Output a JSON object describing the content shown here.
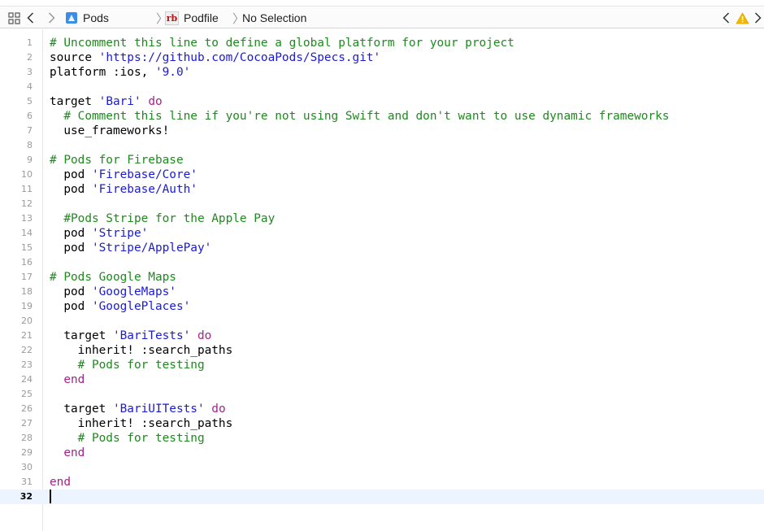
{
  "jumpbar": {
    "breadcrumbs": [
      "Pods",
      "Podfile",
      "No Selection"
    ],
    "icons": {
      "grid": "related-items-grid-icon",
      "back": "chevron-left-icon",
      "forward": "chevron-right-icon",
      "project": "xcode-project-icon",
      "ruby": "ruby-file-icon",
      "warning": "warning-triangle-icon"
    },
    "ruby_icon_label": "rb",
    "colors": {
      "warning": "#f5b800",
      "project_icon": "#3b8ee8"
    }
  },
  "editor": {
    "current_line": 32,
    "colors": {
      "comment": "#1e8a1e",
      "string": "#1a1ad6",
      "keyword": "#a3238c",
      "text": "#000000"
    },
    "lines": [
      {
        "n": "1",
        "segs": [
          {
            "t": "# Uncomment this line to define a global platform for your project",
            "c": "cmt"
          }
        ]
      },
      {
        "n": "2",
        "segs": [
          {
            "t": "source ",
            "c": ""
          },
          {
            "t": "'https://github.com/CocoaPods/Specs.git'",
            "c": "str"
          }
        ]
      },
      {
        "n": "3",
        "segs": [
          {
            "t": "platform :ios, ",
            "c": ""
          },
          {
            "t": "'9.0'",
            "c": "str"
          }
        ]
      },
      {
        "n": "4",
        "segs": []
      },
      {
        "n": "5",
        "segs": [
          {
            "t": "target ",
            "c": ""
          },
          {
            "t": "'Bari'",
            "c": "str"
          },
          {
            "t": " ",
            "c": ""
          },
          {
            "t": "do",
            "c": "kw"
          }
        ]
      },
      {
        "n": "6",
        "segs": [
          {
            "t": "  ",
            "c": ""
          },
          {
            "t": "# Comment this line if you're not using Swift and don't want to use dynamic frameworks",
            "c": "cmt"
          }
        ]
      },
      {
        "n": "7",
        "segs": [
          {
            "t": "  use_frameworks!",
            "c": ""
          }
        ]
      },
      {
        "n": "8",
        "segs": []
      },
      {
        "n": "9",
        "segs": [
          {
            "t": "# Pods for Firebase",
            "c": "cmt"
          }
        ]
      },
      {
        "n": "10",
        "segs": [
          {
            "t": "  pod ",
            "c": ""
          },
          {
            "t": "'Firebase/Core'",
            "c": "str"
          }
        ]
      },
      {
        "n": "11",
        "segs": [
          {
            "t": "  pod ",
            "c": ""
          },
          {
            "t": "'Firebase/Auth'",
            "c": "str"
          }
        ]
      },
      {
        "n": "12",
        "segs": []
      },
      {
        "n": "13",
        "segs": [
          {
            "t": "  ",
            "c": ""
          },
          {
            "t": "#Pods Stripe for the Apple Pay",
            "c": "cmt"
          }
        ]
      },
      {
        "n": "14",
        "segs": [
          {
            "t": "  pod ",
            "c": ""
          },
          {
            "t": "'Stripe'",
            "c": "str"
          }
        ]
      },
      {
        "n": "15",
        "segs": [
          {
            "t": "  pod ",
            "c": ""
          },
          {
            "t": "'Stripe/ApplePay'",
            "c": "str"
          }
        ]
      },
      {
        "n": "16",
        "segs": []
      },
      {
        "n": "17",
        "segs": [
          {
            "t": "# Pods Google Maps",
            "c": "cmt"
          }
        ]
      },
      {
        "n": "18",
        "segs": [
          {
            "t": "  pod ",
            "c": ""
          },
          {
            "t": "'GoogleMaps'",
            "c": "str"
          }
        ]
      },
      {
        "n": "19",
        "segs": [
          {
            "t": "  pod ",
            "c": ""
          },
          {
            "t": "'GooglePlaces'",
            "c": "str"
          }
        ]
      },
      {
        "n": "20",
        "segs": []
      },
      {
        "n": "21",
        "segs": [
          {
            "t": "  target ",
            "c": ""
          },
          {
            "t": "'BariTests'",
            "c": "str"
          },
          {
            "t": " ",
            "c": ""
          },
          {
            "t": "do",
            "c": "kw"
          }
        ]
      },
      {
        "n": "22",
        "segs": [
          {
            "t": "    inherit! :search_paths",
            "c": ""
          }
        ]
      },
      {
        "n": "23",
        "segs": [
          {
            "t": "    ",
            "c": ""
          },
          {
            "t": "# Pods for testing",
            "c": "cmt"
          }
        ]
      },
      {
        "n": "24",
        "segs": [
          {
            "t": "  ",
            "c": ""
          },
          {
            "t": "end",
            "c": "kw"
          }
        ]
      },
      {
        "n": "25",
        "segs": []
      },
      {
        "n": "26",
        "segs": [
          {
            "t": "  target ",
            "c": ""
          },
          {
            "t": "'BariUITests'",
            "c": "str"
          },
          {
            "t": " ",
            "c": ""
          },
          {
            "t": "do",
            "c": "kw"
          }
        ]
      },
      {
        "n": "27",
        "segs": [
          {
            "t": "    inherit! :search_paths",
            "c": ""
          }
        ]
      },
      {
        "n": "28",
        "segs": [
          {
            "t": "    ",
            "c": ""
          },
          {
            "t": "# Pods for testing",
            "c": "cmt"
          }
        ]
      },
      {
        "n": "29",
        "segs": [
          {
            "t": "  ",
            "c": ""
          },
          {
            "t": "end",
            "c": "kw"
          }
        ]
      },
      {
        "n": "30",
        "segs": []
      },
      {
        "n": "31",
        "segs": [
          {
            "t": "end",
            "c": "kw"
          }
        ]
      },
      {
        "n": "32",
        "segs": []
      }
    ]
  }
}
